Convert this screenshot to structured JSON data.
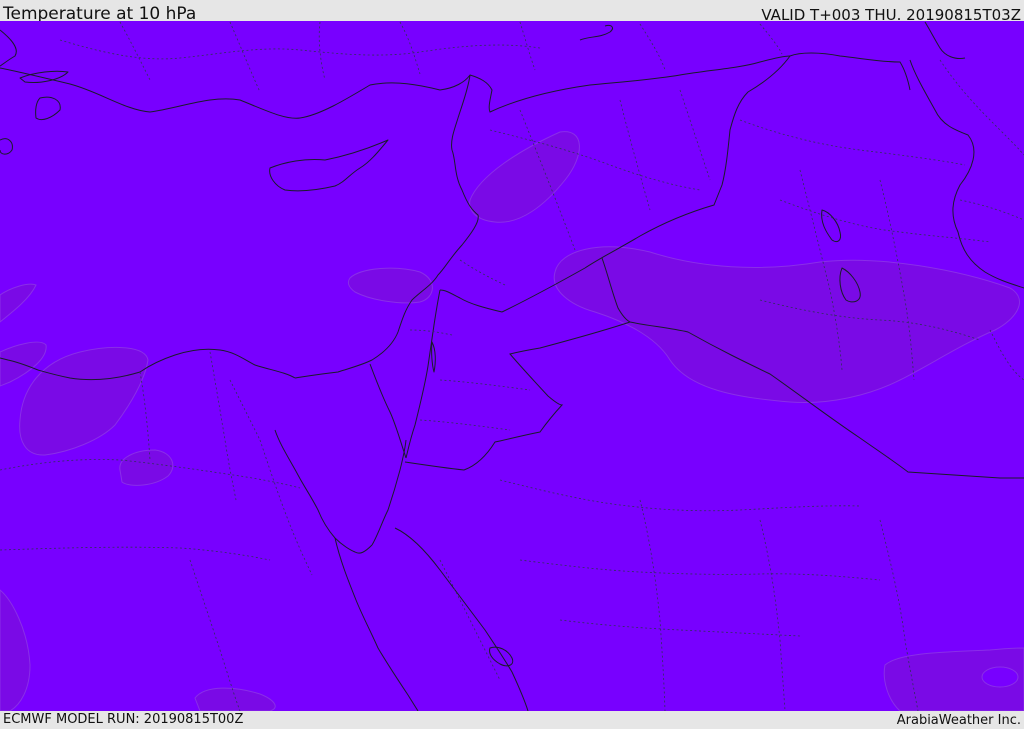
{
  "header": {
    "title": "Temperature at 10 hPa",
    "valid": "VALID T+003 THU. 20190815T03Z"
  },
  "footer": {
    "model_run": "ECMWF MODEL RUN: 20190815T00Z",
    "credit": "ArabiaWeather Inc."
  },
  "map": {
    "background_color": "#7800ff",
    "contour_color": "#7a0ae6",
    "region": "Eastern Mediterranean and Middle East"
  }
}
